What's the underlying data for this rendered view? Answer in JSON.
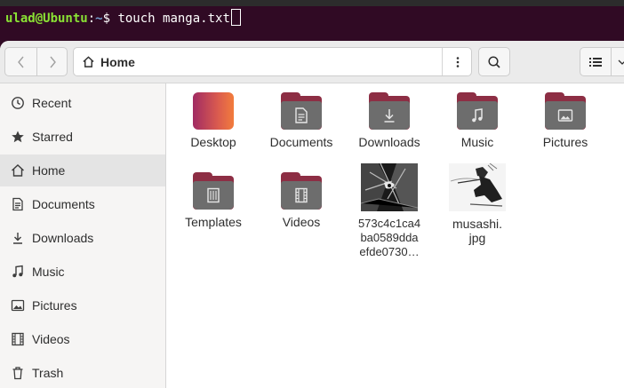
{
  "terminal": {
    "user_host": "ulad@Ubuntu",
    "colon": ":",
    "path": "~",
    "prompt": "$ ",
    "command": "touch manga.txt"
  },
  "header": {
    "location_label": "Home"
  },
  "sidebar": {
    "items": [
      {
        "label": "Recent",
        "icon": "clock-icon"
      },
      {
        "label": "Starred",
        "icon": "star-icon"
      },
      {
        "label": "Home",
        "icon": "home-icon",
        "active": true
      },
      {
        "label": "Documents",
        "icon": "document-icon"
      },
      {
        "label": "Downloads",
        "icon": "download-icon"
      },
      {
        "label": "Music",
        "icon": "music-icon"
      },
      {
        "label": "Pictures",
        "icon": "picture-icon"
      },
      {
        "label": "Videos",
        "icon": "film-icon"
      },
      {
        "label": "Trash",
        "icon": "trash-icon"
      }
    ]
  },
  "files": [
    {
      "label": "Desktop",
      "kind": "desktop-folder"
    },
    {
      "label": "Documents",
      "kind": "folder",
      "icon": "document-icon"
    },
    {
      "label": "Downloads",
      "kind": "folder",
      "icon": "download-icon"
    },
    {
      "label": "Music",
      "kind": "folder",
      "icon": "music-icon"
    },
    {
      "label": "Pictures",
      "kind": "folder",
      "icon": "picture-icon"
    },
    {
      "label": "Templates",
      "kind": "folder",
      "icon": "template-icon"
    },
    {
      "label": "Videos",
      "kind": "folder",
      "icon": "film-icon"
    },
    {
      "label_lines": [
        "573c4c1ca4",
        "ba0589dda",
        "efde0730…"
      ],
      "kind": "image"
    },
    {
      "label_lines": [
        "musashi.",
        "jpg"
      ],
      "kind": "image"
    }
  ],
  "colors": {
    "terminal_bg": "#300a24",
    "folder_tab": "#8d2e44",
    "folder_front": "#6d6d6d",
    "accent_user": "#8ae234",
    "accent_path": "#729fcf"
  }
}
